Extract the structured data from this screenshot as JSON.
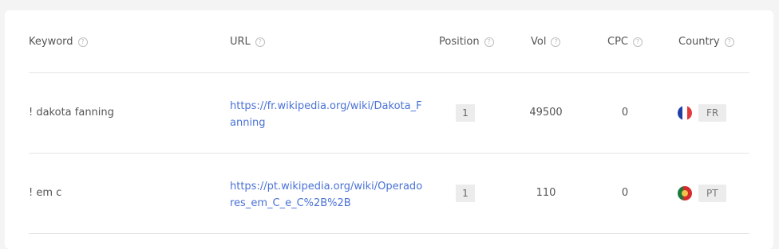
{
  "table": {
    "columns": [
      {
        "label": "Keyword"
      },
      {
        "label": "URL"
      },
      {
        "label": "Position"
      },
      {
        "label": "Vol"
      },
      {
        "label": "CPC"
      },
      {
        "label": "Country"
      }
    ],
    "rows": [
      {
        "keyword": "! dakota fanning",
        "url": "https://fr.wikipedia.org/wiki/Dakota_Fanning",
        "position": "1",
        "vol": "49500",
        "cpc": "0",
        "country_code": "FR",
        "flag": "france-flag-icon"
      },
      {
        "keyword": "! em c",
        "url": "https://pt.wikipedia.org/wiki/Operadores_em_C_e_C%2B%2B",
        "position": "1",
        "vol": "110",
        "cpc": "0",
        "country_code": "PT",
        "flag": "portugal-flag-icon"
      }
    ]
  },
  "colors": {
    "link": "#4a72d6",
    "background": "#f4f4f5",
    "card": "#ffffff",
    "badge": "#ececec"
  }
}
